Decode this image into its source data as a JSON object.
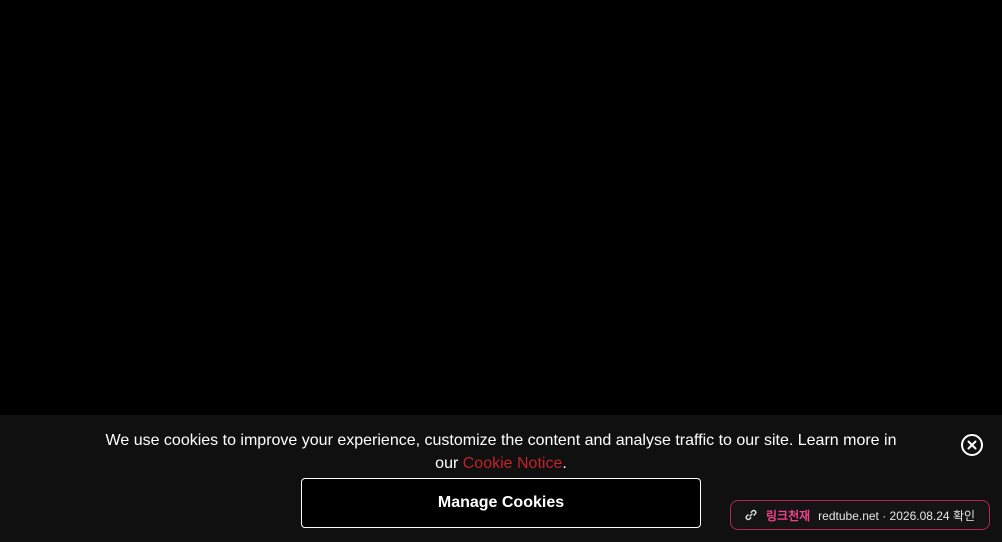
{
  "cookie_banner": {
    "message": "We use cookies to improve your experience, customize the content and analyse traffic to our site. Learn more in our ",
    "link_label": "Cookie Notice",
    "message_end": ".",
    "manage_button_label": "Manage Cookies",
    "close_icon": "close-circle-icon"
  },
  "link_badge": {
    "icon": "link-icon",
    "brand": "링크천재",
    "info": "redtube.net · 2026.08.24 확인"
  },
  "colors": {
    "page_background": "#000000",
    "banner_background": "#101010",
    "link_accent": "#c4202b",
    "badge_accent": "#f0408c"
  }
}
